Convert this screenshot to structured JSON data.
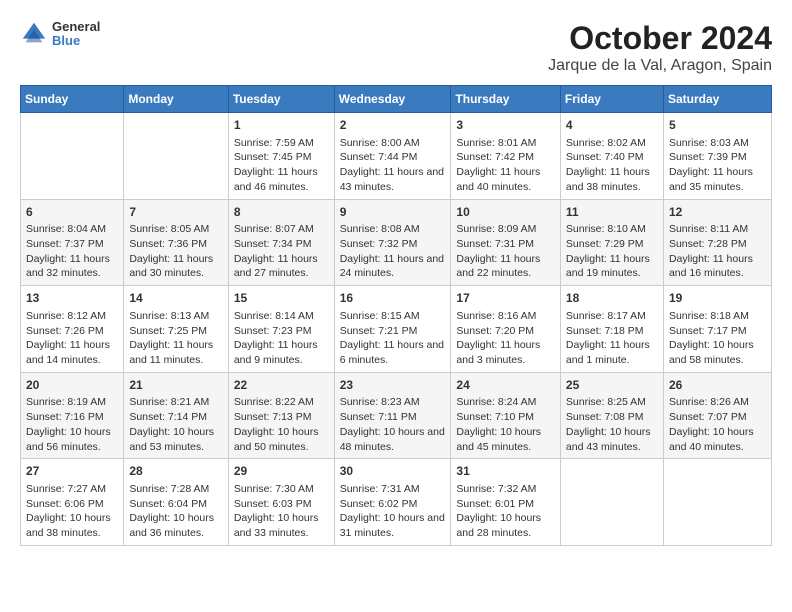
{
  "header": {
    "logo": {
      "general": "General",
      "blue": "Blue"
    },
    "title": "October 2024",
    "subtitle": "Jarque de la Val, Aragon, Spain"
  },
  "weekdays": [
    "Sunday",
    "Monday",
    "Tuesday",
    "Wednesday",
    "Thursday",
    "Friday",
    "Saturday"
  ],
  "weeks": [
    [
      {
        "day": null
      },
      {
        "day": null
      },
      {
        "day": 1,
        "sunrise": "Sunrise: 7:59 AM",
        "sunset": "Sunset: 7:45 PM",
        "daylight": "Daylight: 11 hours and 46 minutes."
      },
      {
        "day": 2,
        "sunrise": "Sunrise: 8:00 AM",
        "sunset": "Sunset: 7:44 PM",
        "daylight": "Daylight: 11 hours and 43 minutes."
      },
      {
        "day": 3,
        "sunrise": "Sunrise: 8:01 AM",
        "sunset": "Sunset: 7:42 PM",
        "daylight": "Daylight: 11 hours and 40 minutes."
      },
      {
        "day": 4,
        "sunrise": "Sunrise: 8:02 AM",
        "sunset": "Sunset: 7:40 PM",
        "daylight": "Daylight: 11 hours and 38 minutes."
      },
      {
        "day": 5,
        "sunrise": "Sunrise: 8:03 AM",
        "sunset": "Sunset: 7:39 PM",
        "daylight": "Daylight: 11 hours and 35 minutes."
      }
    ],
    [
      {
        "day": 6,
        "sunrise": "Sunrise: 8:04 AM",
        "sunset": "Sunset: 7:37 PM",
        "daylight": "Daylight: 11 hours and 32 minutes."
      },
      {
        "day": 7,
        "sunrise": "Sunrise: 8:05 AM",
        "sunset": "Sunset: 7:36 PM",
        "daylight": "Daylight: 11 hours and 30 minutes."
      },
      {
        "day": 8,
        "sunrise": "Sunrise: 8:07 AM",
        "sunset": "Sunset: 7:34 PM",
        "daylight": "Daylight: 11 hours and 27 minutes."
      },
      {
        "day": 9,
        "sunrise": "Sunrise: 8:08 AM",
        "sunset": "Sunset: 7:32 PM",
        "daylight": "Daylight: 11 hours and 24 minutes."
      },
      {
        "day": 10,
        "sunrise": "Sunrise: 8:09 AM",
        "sunset": "Sunset: 7:31 PM",
        "daylight": "Daylight: 11 hours and 22 minutes."
      },
      {
        "day": 11,
        "sunrise": "Sunrise: 8:10 AM",
        "sunset": "Sunset: 7:29 PM",
        "daylight": "Daylight: 11 hours and 19 minutes."
      },
      {
        "day": 12,
        "sunrise": "Sunrise: 8:11 AM",
        "sunset": "Sunset: 7:28 PM",
        "daylight": "Daylight: 11 hours and 16 minutes."
      }
    ],
    [
      {
        "day": 13,
        "sunrise": "Sunrise: 8:12 AM",
        "sunset": "Sunset: 7:26 PM",
        "daylight": "Daylight: 11 hours and 14 minutes."
      },
      {
        "day": 14,
        "sunrise": "Sunrise: 8:13 AM",
        "sunset": "Sunset: 7:25 PM",
        "daylight": "Daylight: 11 hours and 11 minutes."
      },
      {
        "day": 15,
        "sunrise": "Sunrise: 8:14 AM",
        "sunset": "Sunset: 7:23 PM",
        "daylight": "Daylight: 11 hours and 9 minutes."
      },
      {
        "day": 16,
        "sunrise": "Sunrise: 8:15 AM",
        "sunset": "Sunset: 7:21 PM",
        "daylight": "Daylight: 11 hours and 6 minutes."
      },
      {
        "day": 17,
        "sunrise": "Sunrise: 8:16 AM",
        "sunset": "Sunset: 7:20 PM",
        "daylight": "Daylight: 11 hours and 3 minutes."
      },
      {
        "day": 18,
        "sunrise": "Sunrise: 8:17 AM",
        "sunset": "Sunset: 7:18 PM",
        "daylight": "Daylight: 11 hours and 1 minute."
      },
      {
        "day": 19,
        "sunrise": "Sunrise: 8:18 AM",
        "sunset": "Sunset: 7:17 PM",
        "daylight": "Daylight: 10 hours and 58 minutes."
      }
    ],
    [
      {
        "day": 20,
        "sunrise": "Sunrise: 8:19 AM",
        "sunset": "Sunset: 7:16 PM",
        "daylight": "Daylight: 10 hours and 56 minutes."
      },
      {
        "day": 21,
        "sunrise": "Sunrise: 8:21 AM",
        "sunset": "Sunset: 7:14 PM",
        "daylight": "Daylight: 10 hours and 53 minutes."
      },
      {
        "day": 22,
        "sunrise": "Sunrise: 8:22 AM",
        "sunset": "Sunset: 7:13 PM",
        "daylight": "Daylight: 10 hours and 50 minutes."
      },
      {
        "day": 23,
        "sunrise": "Sunrise: 8:23 AM",
        "sunset": "Sunset: 7:11 PM",
        "daylight": "Daylight: 10 hours and 48 minutes."
      },
      {
        "day": 24,
        "sunrise": "Sunrise: 8:24 AM",
        "sunset": "Sunset: 7:10 PM",
        "daylight": "Daylight: 10 hours and 45 minutes."
      },
      {
        "day": 25,
        "sunrise": "Sunrise: 8:25 AM",
        "sunset": "Sunset: 7:08 PM",
        "daylight": "Daylight: 10 hours and 43 minutes."
      },
      {
        "day": 26,
        "sunrise": "Sunrise: 8:26 AM",
        "sunset": "Sunset: 7:07 PM",
        "daylight": "Daylight: 10 hours and 40 minutes."
      }
    ],
    [
      {
        "day": 27,
        "sunrise": "Sunrise: 7:27 AM",
        "sunset": "Sunset: 6:06 PM",
        "daylight": "Daylight: 10 hours and 38 minutes."
      },
      {
        "day": 28,
        "sunrise": "Sunrise: 7:28 AM",
        "sunset": "Sunset: 6:04 PM",
        "daylight": "Daylight: 10 hours and 36 minutes."
      },
      {
        "day": 29,
        "sunrise": "Sunrise: 7:30 AM",
        "sunset": "Sunset: 6:03 PM",
        "daylight": "Daylight: 10 hours and 33 minutes."
      },
      {
        "day": 30,
        "sunrise": "Sunrise: 7:31 AM",
        "sunset": "Sunset: 6:02 PM",
        "daylight": "Daylight: 10 hours and 31 minutes."
      },
      {
        "day": 31,
        "sunrise": "Sunrise: 7:32 AM",
        "sunset": "Sunset: 6:01 PM",
        "daylight": "Daylight: 10 hours and 28 minutes."
      },
      {
        "day": null
      },
      {
        "day": null
      }
    ]
  ]
}
